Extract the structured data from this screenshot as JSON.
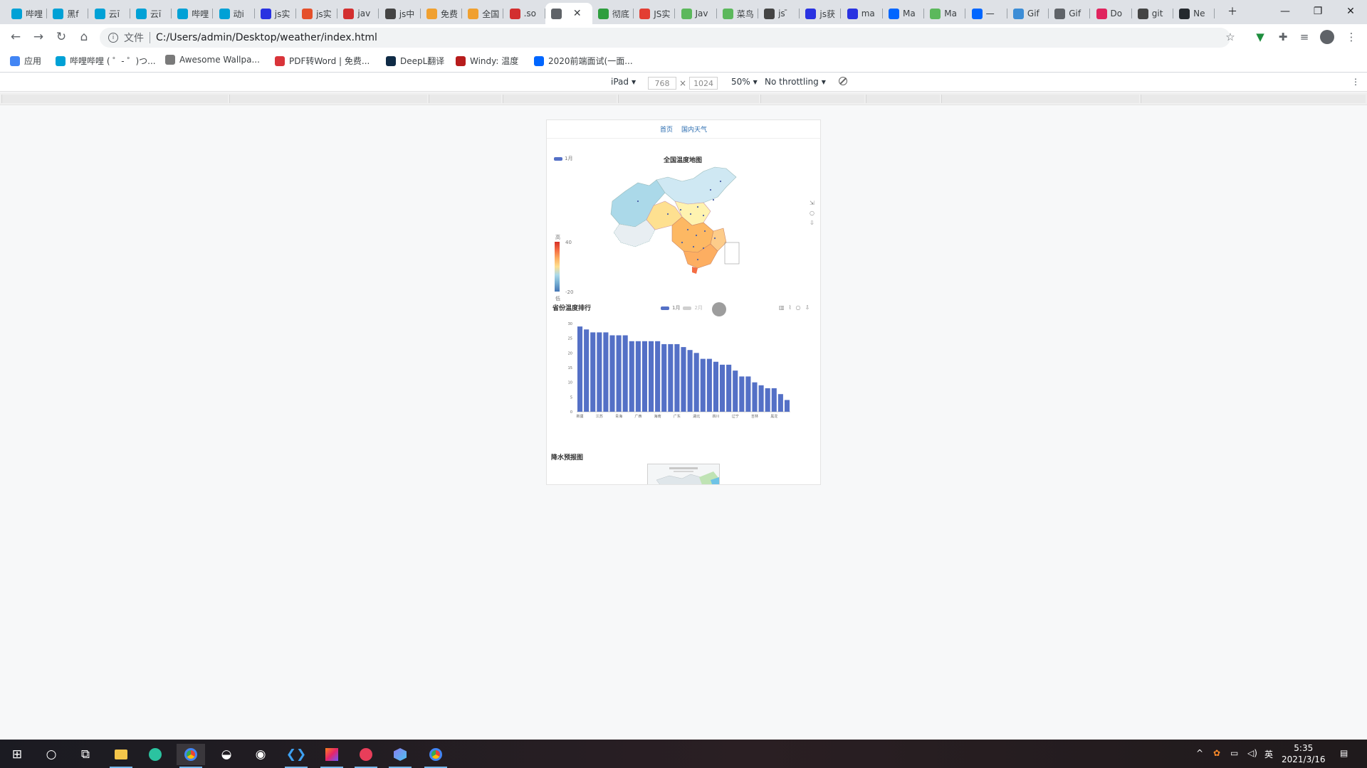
{
  "tabs": [
    {
      "label": "哔哩",
      "icon": "bilibili-icon",
      "color": "#00a1d6"
    },
    {
      "label": "黑f",
      "icon": "bilibili-icon",
      "color": "#00a1d6"
    },
    {
      "label": "云ī",
      "icon": "bilibili-icon",
      "color": "#00a1d6"
    },
    {
      "label": "云ī",
      "icon": "bilibili-icon",
      "color": "#00a1d6"
    },
    {
      "label": "哔哩",
      "icon": "bilibili-icon",
      "color": "#00a1d6"
    },
    {
      "label": "动i",
      "icon": "bilibili-icon",
      "color": "#00a1d6"
    },
    {
      "label": "js实",
      "icon": "baidu-paw-icon",
      "color": "#2932e1"
    },
    {
      "label": "js实",
      "icon": "flame-icon",
      "color": "#e5502a"
    },
    {
      "label": "jav",
      "icon": "house-icon",
      "color": "#d32f2f"
    },
    {
      "label": "js中",
      "icon": "juejin-icon",
      "color": "#444444"
    },
    {
      "label": "免费",
      "icon": "weather-icon",
      "color": "#f0a030"
    },
    {
      "label": "全国",
      "icon": "weather-icon",
      "color": "#f0a030"
    },
    {
      "label": ".so",
      "icon": "house-icon",
      "color": "#d32f2f"
    },
    {
      "label": "",
      "icon": "globe-icon",
      "color": "#5f6368",
      "active": true
    },
    {
      "label": "彻底",
      "icon": "green-leaf-icon",
      "color": "#2e9e3e"
    },
    {
      "label": "JS实",
      "icon": "csdn-icon",
      "color": "#e33e33"
    },
    {
      "label": "Jav",
      "icon": "runoob-icon",
      "color": "#5cb85c"
    },
    {
      "label": "菜鸟",
      "icon": "runoob-icon",
      "color": "#5cb85c"
    },
    {
      "label": "js ̄",
      "icon": "juejin-icon",
      "color": "#444444"
    },
    {
      "label": "js获",
      "icon": "baidu-paw-icon",
      "color": "#2932e1"
    },
    {
      "label": "ma",
      "icon": "baidu-paw-icon",
      "color": "#2932e1"
    },
    {
      "label": "Ma",
      "icon": "zhihu-icon",
      "color": "#0066ff"
    },
    {
      "label": "Ma",
      "icon": "runoob-icon",
      "color": "#5cb85c"
    },
    {
      "label": "一",
      "icon": "zhihu-icon",
      "color": "#0066ff"
    },
    {
      "label": "Gif",
      "icon": "gif-icon",
      "color": "#3c8dd6"
    },
    {
      "label": "Gif",
      "icon": "globe-icon",
      "color": "#5f6368"
    },
    {
      "label": "Do",
      "icon": "douyin-icon",
      "color": "#e0245e"
    },
    {
      "label": "git",
      "icon": "juejin-icon",
      "color": "#444444"
    },
    {
      "label": "Ne",
      "icon": "github-icon",
      "color": "#24292e"
    }
  ],
  "toolbar": {
    "url_prefix": "文件",
    "url": "C:/Users/admin/Desktop/weather/index.html"
  },
  "bookmarks": [
    {
      "label": "应用",
      "icon": "apps-grid-icon",
      "color": "#4285f4"
    },
    {
      "label": "哔哩哔哩 ( ゜- ゜)つ...",
      "icon": "bilibili-icon",
      "color": "#00a1d6"
    },
    {
      "label": "Awesome Wallpa...",
      "icon": "wallpaper-icon",
      "color": "#7a7a7a"
    },
    {
      "label": "PDF转Word | 免费...",
      "icon": "pdf-icon",
      "color": "#d9343a"
    },
    {
      "label": "DeepL翻译",
      "icon": "deepl-icon",
      "color": "#0f2b46"
    },
    {
      "label": "Windy: 温度",
      "icon": "windy-icon",
      "color": "#b71c1c"
    },
    {
      "label": "2020前端面试(一面...",
      "icon": "zhihu-icon",
      "color": "#0066ff"
    }
  ],
  "device_toolbar": {
    "device": "iPad",
    "width": "768",
    "height": "1024",
    "zoom": "50%",
    "throttling": "No throttling"
  },
  "page": {
    "nav": [
      "首页",
      "国内天气"
    ],
    "map": {
      "legend": "1月",
      "title": "全国温度地图",
      "visual_map": {
        "top": "高",
        "bottom": "低",
        "max": "40",
        "min": "-20"
      }
    },
    "bar": {
      "title": "省份温度排行",
      "legend": [
        "1月",
        "2月"
      ]
    },
    "rain": {
      "title": "降水预报图"
    }
  },
  "chart_data": {
    "type": "bar",
    "title": "省份温度排行",
    "series": [
      {
        "name": "1月",
        "values": [
          29,
          28,
          27,
          27,
          27,
          26,
          26,
          26,
          24,
          24,
          24,
          24,
          24,
          23,
          23,
          23,
          22,
          21,
          20,
          18,
          18,
          17,
          16,
          16,
          14,
          12,
          12,
          10,
          9,
          8,
          8,
          6,
          4
        ]
      }
    ],
    "x_tick_labels": [
      "新疆",
      "江苏",
      "青海",
      "广西",
      "海南",
      "广东",
      "湖北",
      "四川",
      "辽宁",
      "吉林",
      "黑龙"
    ],
    "ylim": [
      0,
      30
    ],
    "y_ticks": [
      0,
      5,
      10,
      15,
      20,
      25,
      30
    ],
    "color": "#5470c6",
    "grid": false
  },
  "taskbar": {
    "time": "5:35",
    "date": "2021/3/16",
    "ime": "英"
  }
}
